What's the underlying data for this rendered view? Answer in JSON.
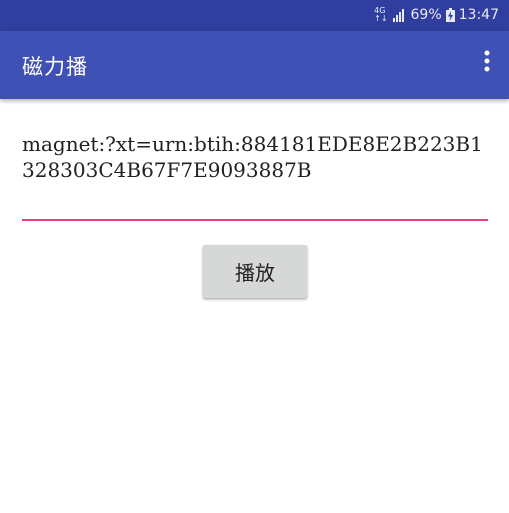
{
  "colors": {
    "status_bar": "#303F9F",
    "app_bar": "#3F51B5",
    "accent": "#EC407A",
    "button_bg": "#D6D7D7"
  },
  "status_bar": {
    "network_top": "4G",
    "network_bottom": "↑↓",
    "signal_icon": "signal-bars-icon",
    "battery_percent": "69%",
    "battery_icon": "battery-charging-icon",
    "time": "13:47"
  },
  "app_bar": {
    "title": "磁力播",
    "overflow_icon": "more-vertical-icon"
  },
  "main": {
    "magnet_value": "magnet:?xt=urn:btih:884181EDE8E2B223B1328303C4B67F7E9093887B",
    "play_label": "播放"
  }
}
